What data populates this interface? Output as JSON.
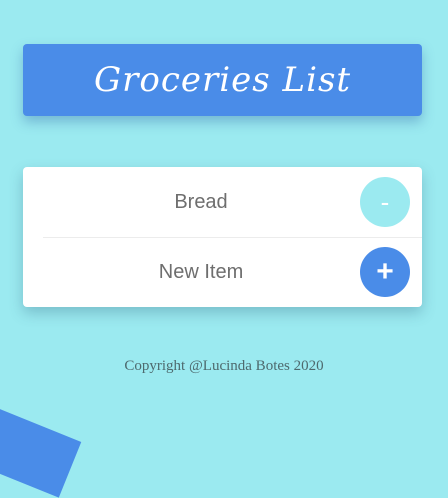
{
  "header": {
    "title": "Groceries List"
  },
  "list": {
    "items": [
      {
        "label": "Bread",
        "action_label": "-"
      }
    ],
    "new_item": {
      "placeholder": "New Item",
      "value": "",
      "action_label": "+"
    }
  },
  "footer": {
    "copyright": "Copyright @Lucinda Botes 2020"
  },
  "colors": {
    "background": "#9beaf0",
    "accent": "#4a8ce8",
    "card": "#ffffff",
    "text": "#6e6e6e"
  }
}
